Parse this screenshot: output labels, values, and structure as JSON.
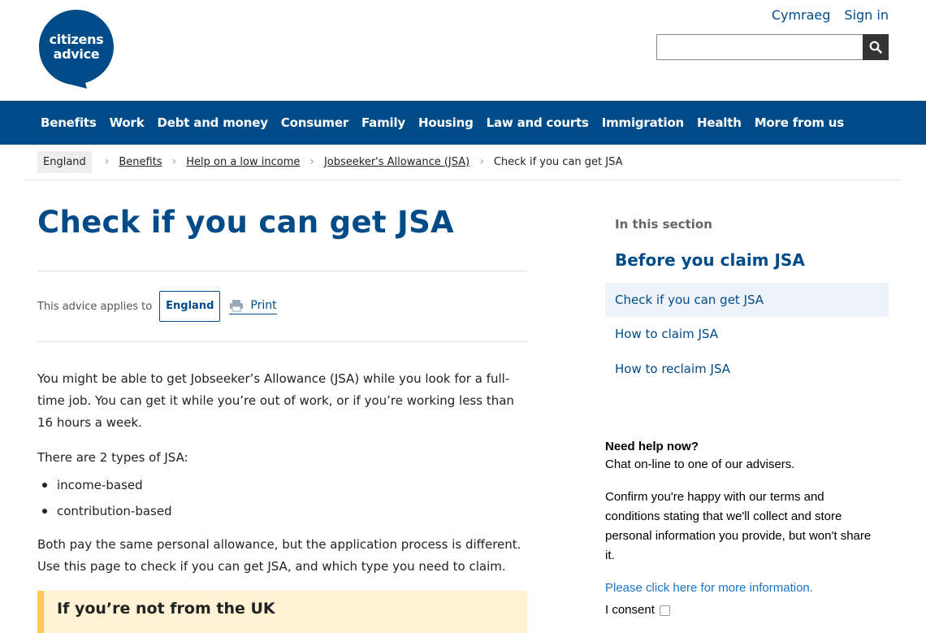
{
  "brand": {
    "logo_line1": "citizens",
    "logo_line2": "advice",
    "primary": "#004b88",
    "callout_border": "#ffcc4e",
    "callout_bg": "#fff2d5"
  },
  "top_links": {
    "welsh": "Cymraeg",
    "sign_in": "Sign in"
  },
  "search": {
    "placeholder": "",
    "icon": "search-icon"
  },
  "nav": [
    "Benefits",
    "Work",
    "Debt and money",
    "Consumer",
    "Family",
    "Housing",
    "Law and courts",
    "Immigration",
    "Health",
    "More from us"
  ],
  "breadcrumb": {
    "home": "England",
    "items": [
      "Benefits",
      "Help on a low income",
      "Jobseeker's Allowance (JSA)"
    ],
    "current": "Check if you can get JSA"
  },
  "page": {
    "title": "Check if you can get JSA",
    "applies_label": "This advice applies to",
    "applies_region": "England",
    "print_label": "Print",
    "para1": "You might be able to get Jobseeker’s Allowance (JSA) while you look for a full-time job. You can get it while you’re out of work, or if you’re working less than 16 hours a week.",
    "para2": "There are 2 types of JSA:",
    "list": [
      "income-based",
      "contribution-based"
    ],
    "para3": "Both pay the same personal allowance, but the application process is different. Use this page to check if you can get JSA, and which type you need to claim.",
    "callout_title": "If you’re not from the UK"
  },
  "sidebar": {
    "heading": "In this section",
    "subheading": "Before you claim JSA",
    "items": [
      "Check if you can get JSA",
      "How to claim JSA",
      "How to reclaim JSA"
    ]
  },
  "chat": {
    "title": "Need help now?",
    "line": "Chat on-line to one of our advisers.",
    "confirm": "Confirm you're happy with our terms and conditions stating that we'll collect and store personal information you provide, but won't share it.",
    "link": "Please click here for more information.",
    "consent": "I consent"
  }
}
